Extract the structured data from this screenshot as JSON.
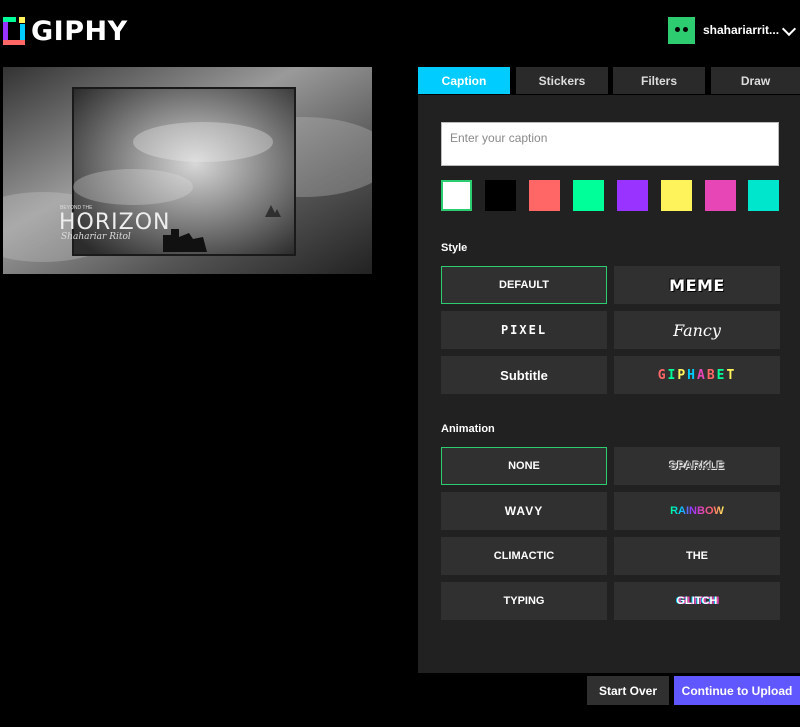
{
  "header": {
    "logo_text": "GIPHY",
    "username": "shahariarrit...",
    "avatar_color": "#2ecc71"
  },
  "preview": {
    "overlay_small": "BEYOND THE",
    "overlay_title": "HORIZON",
    "overlay_script": "Shahariar Ritol"
  },
  "tabs": [
    "Caption",
    "Stickers",
    "Filters",
    "Draw"
  ],
  "active_tab": "Caption",
  "caption": {
    "placeholder": "Enter your caption",
    "value": ""
  },
  "colors": [
    "#ffffff",
    "#000000",
    "#ff6666",
    "#00ff99",
    "#9933ff",
    "#fff35c",
    "#e646b6",
    "#00e6cc"
  ],
  "selected_color": "#ffffff",
  "style": {
    "label": "Style",
    "options": [
      "DEFAULT",
      "MEME",
      "PIXEL",
      "Fancy",
      "Subtitle",
      "GIPHABET"
    ],
    "selected": "DEFAULT"
  },
  "animation": {
    "label": "Animation",
    "options": [
      "NONE",
      "SPARKLE",
      "WAVY",
      "RAINBOW",
      "CLIMACTIC",
      "THE",
      "TYPING",
      "GLITCH"
    ],
    "selected": "NONE"
  },
  "footer": {
    "start_over": "Start Over",
    "continue": "Continue to Upload"
  },
  "accent": {
    "tab": "#00ccff",
    "selection": "#2ecc71",
    "continue_button": "#6157ff"
  }
}
